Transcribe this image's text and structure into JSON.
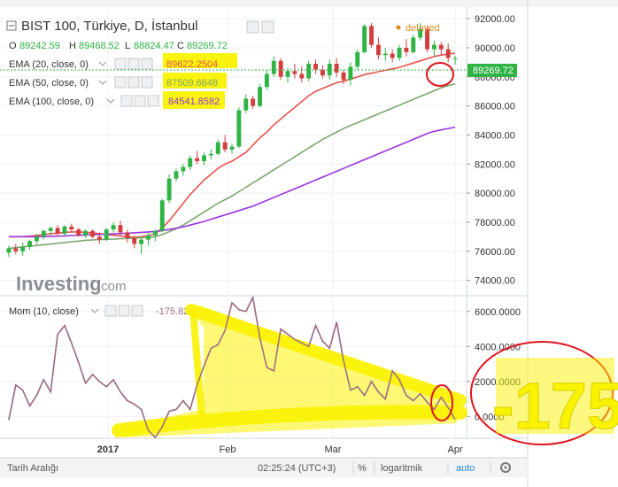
{
  "header": {
    "title": "BIST 100, Türkiye, D, İstanbul",
    "status": "delayed",
    "ohlc": {
      "o_label": "O",
      "o": "89242.59",
      "h_label": "H",
      "h": "89468.52",
      "l_label": "L",
      "l": "88824.47",
      "c_label": "C",
      "c": "89269.72"
    }
  },
  "indicators": [
    {
      "label": "EMA (20, close, 0)",
      "value": "89622.2504",
      "color": "#e9524f"
    },
    {
      "label": "EMA (50, close, 0)",
      "value": "87509.6648",
      "color": "#7da56e"
    },
    {
      "label": "EMA (100, close, 0)",
      "value": "84541.8582",
      "color": "#9b35e0"
    }
  ],
  "watermark": {
    "brand": "Investing",
    "suffix": ".com"
  },
  "price_badge": "89269.72",
  "momentum": {
    "label": "Mom (10, close)",
    "value": "-175.828"
  },
  "annotation": "-175",
  "footer": {
    "range_label": "Tarih Aralığı",
    "time": "02:25:24 (UTC+3)",
    "percent": "%",
    "log": "logaritmik",
    "auto": "auto"
  },
  "colors": {
    "up": "#2fb344",
    "down": "#d43d3d",
    "ema20": "#e9524f",
    "ema50": "#7da56e",
    "ema100": "#9b35e0",
    "momentum": "#9d6d86",
    "highlight": "#f9f200",
    "markup": "#e0141e"
  },
  "chart_data": [
    {
      "type": "candlestick",
      "title": "BIST 100, Türkiye, D, İstanbul",
      "ylim": [
        73000,
        92800
      ],
      "yticks": [
        "74000.00",
        "76000.00",
        "78000.00",
        "80000.00",
        "82000.00",
        "84000.00",
        "86000.00",
        "88000.00",
        "90000.00",
        "92000.00"
      ],
      "xticks": [
        "2017",
        "Feb",
        "Mar",
        "Apr"
      ],
      "overlays": [
        {
          "name": "EMA (20, close, 0)",
          "last": 89622.2504,
          "values": [
            77000,
            77000,
            77010,
            77040,
            77090,
            77150,
            77200,
            77250,
            77300,
            77330,
            77330,
            77300,
            77260,
            77210,
            77150,
            77100,
            77050,
            77000,
            76960,
            77000,
            77080,
            77200,
            77600,
            78100,
            78700,
            79300,
            79900,
            80400,
            80900,
            81300,
            81700,
            82000,
            82200,
            82500,
            82800,
            83300,
            83800,
            84200,
            84700,
            85100,
            85500,
            85900,
            86300,
            86700,
            87000,
            87200,
            87400,
            87600,
            87700,
            87850,
            88000,
            88150,
            88250,
            88350,
            88450,
            88550,
            88650,
            88800,
            88950,
            89100,
            89250,
            89400,
            89500,
            89580,
            89620
          ]
        },
        {
          "name": "EMA (50, close, 0)",
          "last": 87509.6648,
          "values": [
            76200,
            76250,
            76300,
            76350,
            76400,
            76450,
            76500,
            76550,
            76600,
            76650,
            76700,
            76750,
            76780,
            76800,
            76820,
            76840,
            76860,
            76880,
            76900,
            76930,
            76960,
            77000,
            77150,
            77350,
            77550,
            77800,
            78100,
            78400,
            78700,
            79000,
            79300,
            79550,
            79800,
            80100,
            80400,
            80700,
            81000,
            81300,
            81600,
            81900,
            82200,
            82500,
            82800,
            83100,
            83400,
            83700,
            83950,
            84200,
            84450,
            84650,
            84850,
            85050,
            85250,
            85450,
            85650,
            85850,
            86050,
            86250,
            86450,
            86650,
            86850,
            87050,
            87250,
            87400,
            87510
          ]
        },
        {
          "name": "EMA (100, close, 0)",
          "last": 84541.8582,
          "values": [
            77000,
            77000,
            77000,
            77000,
            77000,
            77000,
            77020,
            77040,
            77060,
            77080,
            77100,
            77120,
            77140,
            77160,
            77180,
            77200,
            77220,
            77240,
            77270,
            77300,
            77330,
            77360,
            77420,
            77500,
            77580,
            77680,
            77800,
            77920,
            78050,
            78200,
            78350,
            78500,
            78650,
            78800,
            78950,
            79100,
            79300,
            79500,
            79700,
            79900,
            80100,
            80300,
            80500,
            80700,
            80900,
            81100,
            81300,
            81500,
            81700,
            81900,
            82100,
            82300,
            82500,
            82700,
            82900,
            83100,
            83300,
            83500,
            83700,
            83900,
            84100,
            84250,
            84350,
            84450,
            84540
          ]
        }
      ],
      "candles": [
        {
          "o": 75900,
          "h": 76400,
          "l": 75600,
          "c": 76200
        },
        {
          "o": 76200,
          "h": 76500,
          "l": 75800,
          "c": 76000
        },
        {
          "o": 76000,
          "h": 76600,
          "l": 75700,
          "c": 76300
        },
        {
          "o": 76300,
          "h": 76800,
          "l": 76100,
          "c": 76700
        },
        {
          "o": 76700,
          "h": 77200,
          "l": 76500,
          "c": 77000
        },
        {
          "o": 77000,
          "h": 77500,
          "l": 76800,
          "c": 77400
        },
        {
          "o": 77400,
          "h": 77700,
          "l": 77100,
          "c": 77600
        },
        {
          "o": 77600,
          "h": 77800,
          "l": 77000,
          "c": 77200
        },
        {
          "o": 77200,
          "h": 77800,
          "l": 77100,
          "c": 77700
        },
        {
          "o": 77700,
          "h": 77900,
          "l": 77300,
          "c": 77500
        },
        {
          "o": 77500,
          "h": 77600,
          "l": 77000,
          "c": 77100
        },
        {
          "o": 77100,
          "h": 77500,
          "l": 76900,
          "c": 77400
        },
        {
          "o": 77400,
          "h": 77500,
          "l": 76900,
          "c": 77000
        },
        {
          "o": 77000,
          "h": 77300,
          "l": 76500,
          "c": 76800
        },
        {
          "o": 76800,
          "h": 77600,
          "l": 76700,
          "c": 77500
        },
        {
          "o": 77500,
          "h": 78000,
          "l": 77300,
          "c": 77800
        },
        {
          "o": 77800,
          "h": 78100,
          "l": 77100,
          "c": 77300
        },
        {
          "o": 77300,
          "h": 77500,
          "l": 76600,
          "c": 76900
        },
        {
          "o": 76900,
          "h": 77100,
          "l": 76200,
          "c": 76500
        },
        {
          "o": 76500,
          "h": 77000,
          "l": 75800,
          "c": 76800
        },
        {
          "o": 76800,
          "h": 77300,
          "l": 76400,
          "c": 77100
        },
        {
          "o": 77100,
          "h": 77500,
          "l": 76700,
          "c": 77400
        },
        {
          "o": 77400,
          "h": 79600,
          "l": 77300,
          "c": 79500
        },
        {
          "o": 79500,
          "h": 81300,
          "l": 79300,
          "c": 81000
        },
        {
          "o": 81000,
          "h": 81700,
          "l": 80800,
          "c": 81500
        },
        {
          "o": 81500,
          "h": 82000,
          "l": 81200,
          "c": 81800
        },
        {
          "o": 81800,
          "h": 82600,
          "l": 81600,
          "c": 82400
        },
        {
          "o": 82400,
          "h": 82900,
          "l": 82000,
          "c": 82200
        },
        {
          "o": 82200,
          "h": 82800,
          "l": 81900,
          "c": 82600
        },
        {
          "o": 82600,
          "h": 83000,
          "l": 82300,
          "c": 82700
        },
        {
          "o": 82700,
          "h": 83700,
          "l": 82600,
          "c": 83500
        },
        {
          "o": 83500,
          "h": 84000,
          "l": 82800,
          "c": 83000
        },
        {
          "o": 83000,
          "h": 83400,
          "l": 82700,
          "c": 83200
        },
        {
          "o": 83200,
          "h": 85900,
          "l": 83100,
          "c": 85700
        },
        {
          "o": 85700,
          "h": 86800,
          "l": 85500,
          "c": 86500
        },
        {
          "o": 86500,
          "h": 86700,
          "l": 85800,
          "c": 86000
        },
        {
          "o": 86000,
          "h": 87500,
          "l": 85900,
          "c": 87300
        },
        {
          "o": 87300,
          "h": 88500,
          "l": 87100,
          "c": 88200
        },
        {
          "o": 88200,
          "h": 89400,
          "l": 88000,
          "c": 89100
        },
        {
          "o": 89100,
          "h": 89300,
          "l": 87800,
          "c": 88000
        },
        {
          "o": 88000,
          "h": 88600,
          "l": 87600,
          "c": 88400
        },
        {
          "o": 88400,
          "h": 88900,
          "l": 87900,
          "c": 88200
        },
        {
          "o": 88200,
          "h": 88700,
          "l": 87600,
          "c": 87900
        },
        {
          "o": 87900,
          "h": 89100,
          "l": 87700,
          "c": 88900
        },
        {
          "o": 88900,
          "h": 89200,
          "l": 88200,
          "c": 88500
        },
        {
          "o": 88500,
          "h": 88800,
          "l": 87900,
          "c": 88100
        },
        {
          "o": 88100,
          "h": 89200,
          "l": 87800,
          "c": 88900
        },
        {
          "o": 88900,
          "h": 89300,
          "l": 88000,
          "c": 88300
        },
        {
          "o": 88300,
          "h": 88500,
          "l": 87500,
          "c": 87800
        },
        {
          "o": 87800,
          "h": 89000,
          "l": 87400,
          "c": 88700
        },
        {
          "o": 88700,
          "h": 89900,
          "l": 88500,
          "c": 89700
        },
        {
          "o": 89700,
          "h": 91600,
          "l": 89600,
          "c": 91500
        },
        {
          "o": 91500,
          "h": 91700,
          "l": 90000,
          "c": 90200
        },
        {
          "o": 90200,
          "h": 90700,
          "l": 89200,
          "c": 89500
        },
        {
          "o": 89500,
          "h": 90000,
          "l": 89100,
          "c": 89600
        },
        {
          "o": 89600,
          "h": 89900,
          "l": 89000,
          "c": 89300
        },
        {
          "o": 89300,
          "h": 90200,
          "l": 89100,
          "c": 90000
        },
        {
          "o": 90000,
          "h": 90600,
          "l": 89400,
          "c": 89700
        },
        {
          "o": 89700,
          "h": 90900,
          "l": 89600,
          "c": 90700
        },
        {
          "o": 90700,
          "h": 91700,
          "l": 90500,
          "c": 91300
        },
        {
          "o": 91300,
          "h": 91500,
          "l": 89700,
          "c": 89900
        },
        {
          "o": 89900,
          "h": 90500,
          "l": 89400,
          "c": 90200
        },
        {
          "o": 90200,
          "h": 90400,
          "l": 89500,
          "c": 89900
        },
        {
          "o": 89900,
          "h": 90300,
          "l": 89000,
          "c": 89300
        },
        {
          "o": 89242.59,
          "h": 89468.52,
          "l": 88824.47,
          "c": 89269.72
        }
      ]
    },
    {
      "type": "line",
      "title": "Mom (10, close)",
      "ylim": [
        -1200,
        6800
      ],
      "yticks": [
        "0.0000",
        "2000.0000",
        "4000.0000",
        "6000.0000"
      ],
      "series": [
        {
          "name": "Mom (10, close)",
          "last": -175.828,
          "values": [
            -200,
            1800,
            1500,
            600,
            1200,
            2100,
            1400,
            4700,
            5200,
            4200,
            3100,
            1900,
            2400,
            2000,
            1700,
            2100,
            1400,
            900,
            700,
            400,
            -800,
            -1200,
            -600,
            300,
            400,
            900,
            400,
            1800,
            2900,
            3900,
            4100,
            4900,
            6500,
            6100,
            6000,
            6800,
            4500,
            2800,
            2600,
            5000,
            4700,
            4400,
            4200,
            4000,
            5200,
            4300,
            3900,
            5400,
            3200,
            1500,
            1700,
            1200,
            2000,
            1400,
            1000,
            2600,
            2100,
            1200,
            900,
            1300,
            800,
            400,
            1100,
            500,
            -175.828
          ]
        }
      ],
      "xticks": [
        "2017",
        "Feb",
        "Mar",
        "Apr"
      ]
    }
  ]
}
